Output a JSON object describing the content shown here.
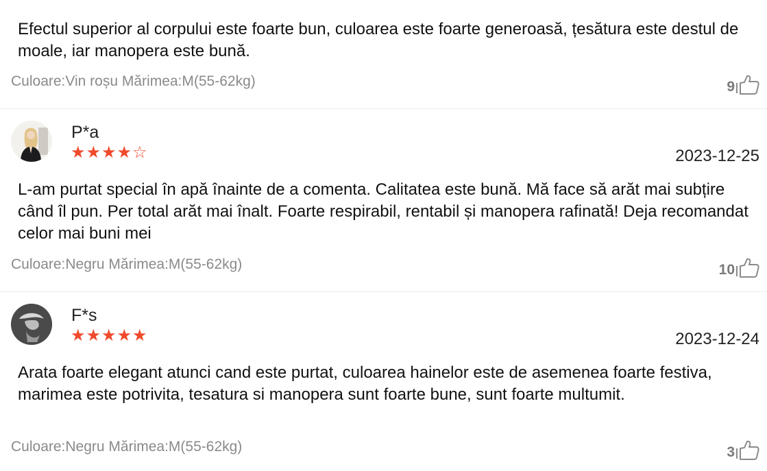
{
  "reviews": [
    {
      "text": "Efectul superior al corpului este foarte bun, culoarea este foarte generoasă, țesătura este destul de moale, iar manopera este bună.",
      "attributes": "Culoare:Vin roșu Mărimea:M(55-62kg)",
      "likes": "9"
    },
    {
      "username": "P*a",
      "rating": 4,
      "rating_max": 5,
      "date": "2023-12-25",
      "text": "L-am purtat special în apă înainte de a comenta. Calitatea este bună. Mă face să arăt mai subțire când îl pun. Per total arăt mai înalt. Foarte respirabil, rentabil și manopera rafinată! Deja recomandat celor mai buni mei",
      "attributes": "Culoare:Negru Mărimea:M(55-62kg)",
      "likes": "10"
    },
    {
      "username": "F*s",
      "rating": 5,
      "rating_max": 5,
      "date": "2023-12-24",
      "text": "Arata foarte elegant atunci cand este purtat, culoarea hainelor este de asemenea foarte festiva, marimea este potrivita, tesatura si manopera sunt foarte bune, sunt foarte multumit.",
      "attributes": "Culoare:Negru Mărimea:M(55-62kg)",
      "likes": "3"
    }
  ],
  "icons": {
    "like": "thumbs-up-icon",
    "star_filled": "star-filled-icon",
    "star_empty": "star-outline-icon"
  },
  "colors": {
    "star": "#f04a2d",
    "meta_text": "#8a8a8a",
    "like_count": "#7a7a7a"
  }
}
